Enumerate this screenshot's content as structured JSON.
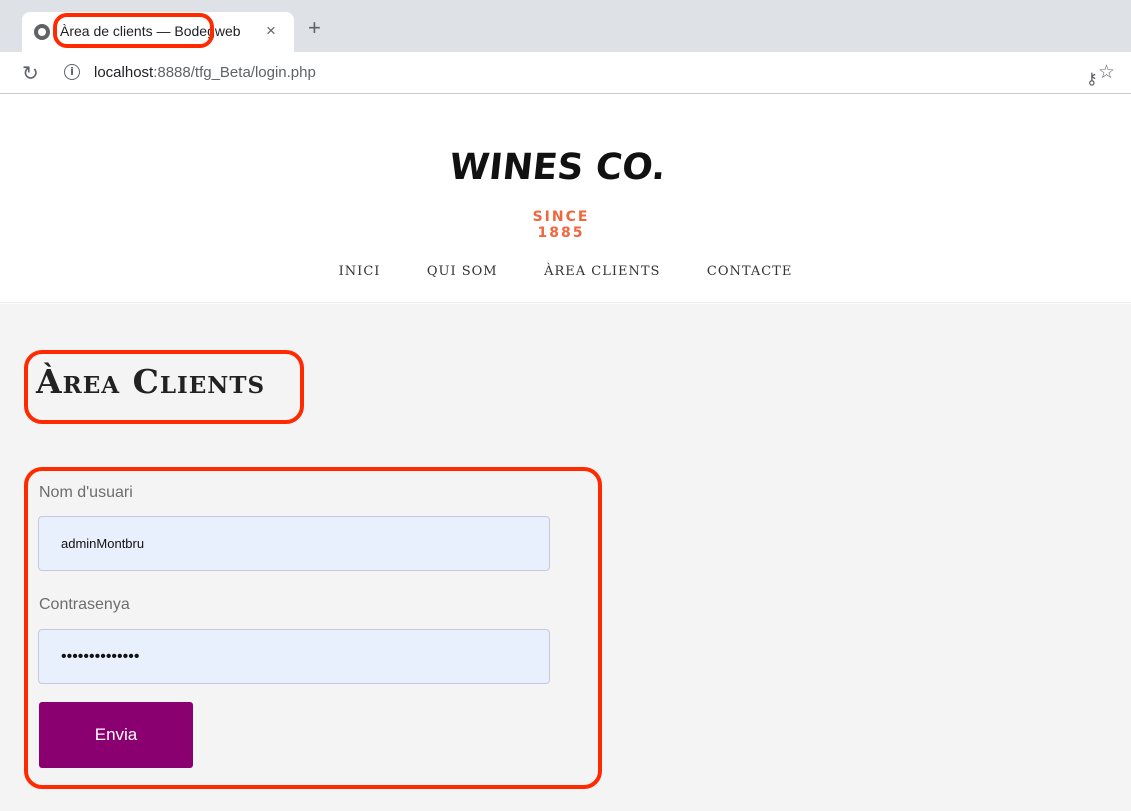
{
  "browser": {
    "tab_title": "Àrea de clients — Bodegweb",
    "tab_close": "×",
    "new_tab": "+",
    "reload": "↻",
    "url_host": "localhost",
    "url_path": ":8888/tfg_Beta/login.php",
    "icons": [
      "globe-icon",
      "close-icon",
      "plus-icon",
      "reload-icon",
      "info-icon",
      "key-icon",
      "star-icon"
    ]
  },
  "site": {
    "logo": {
      "wordmark": "WINES CO.",
      "tagline": "SINCE 1885",
      "accent_color": "#f0663e"
    },
    "nav": [
      "INICI",
      "QUI SOM",
      "ÀREA CLIENTS",
      "CONTACTE"
    ]
  },
  "main": {
    "title": "Àrea Clients",
    "form": {
      "username_label": "Nom d'usuari",
      "username_value": "adminMontbru",
      "password_label": "Contrasenya",
      "password_value": "••••••••••••••",
      "submit_label": "Envia"
    }
  },
  "colors": {
    "annotation": "#ff2a00",
    "button": "#8b0070",
    "input_bg": "#e8f0fe",
    "page_bg": "#f4f4f4"
  }
}
